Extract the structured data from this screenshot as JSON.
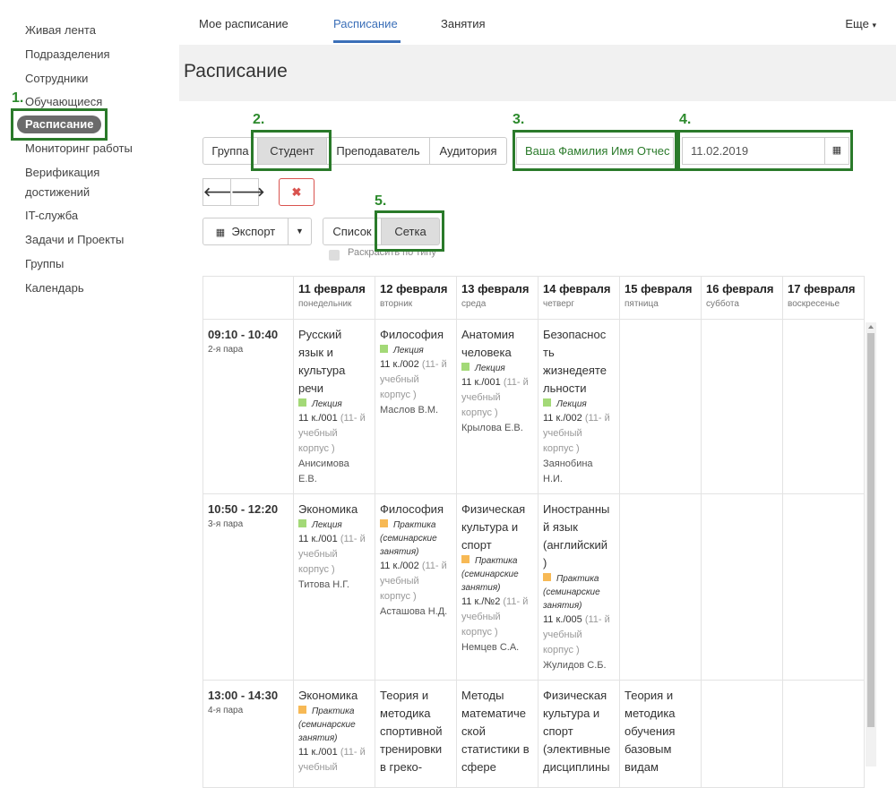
{
  "sidebar": {
    "items": [
      {
        "label": "Живая лента"
      },
      {
        "label": "Подразделения"
      },
      {
        "label": "Сотрудники"
      },
      {
        "label": "Обучающиеся"
      },
      {
        "label": "Расписание"
      },
      {
        "label": "Мониторинг работы"
      },
      {
        "label": "Верификация"
      },
      {
        "label": "достижений"
      },
      {
        "label": "IT-служба"
      },
      {
        "label": "Задачи и Проекты"
      },
      {
        "label": "Группы"
      },
      {
        "label": "Календарь"
      }
    ]
  },
  "annotations": [
    "1.",
    "2.",
    "3.",
    "4.",
    "5."
  ],
  "topnav": {
    "tabs": [
      {
        "label": "Мое расписание"
      },
      {
        "label": "Расписание"
      },
      {
        "label": "Занятия"
      }
    ],
    "more": "Еще"
  },
  "page_title": "Расписание",
  "filters": {
    "group": "Группа",
    "student": "Студент",
    "teacher": "Преподаватель",
    "room": "Аудитория"
  },
  "student_name": "Ваша Фамилия Имя Отчес",
  "date": "11.02.2019",
  "export_label": "Экспорт",
  "view": {
    "list": "Список",
    "grid": "Сетка"
  },
  "color_by_type": "Раскрасить по типу",
  "colors": {
    "lecture": "#a3d977",
    "practice": "#f7b955",
    "accent": "#3b6fb8",
    "annotation": "#2a7a2a"
  },
  "days": [
    {
      "date": "11 февраля",
      "dow": "понедельник"
    },
    {
      "date": "12 февраля",
      "dow": "вторник"
    },
    {
      "date": "13 февраля",
      "dow": "среда"
    },
    {
      "date": "14 февраля",
      "dow": "четверг"
    },
    {
      "date": "15 февраля",
      "dow": "пятница"
    },
    {
      "date": "16 февраля",
      "dow": "суббота"
    },
    {
      "date": "17 февраля",
      "dow": "воскресенье"
    }
  ],
  "slots": [
    {
      "time": "09:10 - 10:40",
      "pair": "2-я пара",
      "cells": [
        {
          "subject": [
            "Русский",
            "язык и",
            "культура",
            "речи"
          ],
          "type": "Лекция",
          "room": "11 к./001",
          "room_sub": [
            "(11-",
            "й учебный",
            "корпус )"
          ],
          "teacher": [
            "Анисимова",
            "Е.В."
          ]
        },
        {
          "subject": [
            "Философия"
          ],
          "type": "Лекция",
          "room": "11 к./002",
          "room_sub": [
            "(11-",
            "й учебный",
            "корпус )"
          ],
          "teacher": [
            "Маслов В.М."
          ]
        },
        {
          "subject": [
            "Анатомия",
            "человека"
          ],
          "type": "Лекция",
          "room": "11 к./001",
          "room_sub": [
            "(11-",
            "й учебный",
            "корпус )"
          ],
          "teacher": [
            "Крылова Е.В."
          ]
        },
        {
          "subject": [
            "Безопаснос",
            "ть",
            "жизнедеяте",
            "льности"
          ],
          "type": "Лекция",
          "room": "11 к./002",
          "room_sub": [
            "(11-",
            "й учебный",
            "корпус )"
          ],
          "teacher": [
            "Заянобина",
            "Н.И."
          ]
        }
      ]
    },
    {
      "time": "10:50 - 12:20",
      "pair": "3-я пара",
      "cells": [
        {
          "subject": [
            "Экономика"
          ],
          "type": "Лекция",
          "room": "11 к./001",
          "room_sub": [
            "(11-",
            "й учебный",
            "корпус )"
          ],
          "teacher": [
            "Титова Н.Г."
          ]
        },
        {
          "subject": [
            "Философия"
          ],
          "type": "Практика (семинарские занятия)",
          "room": "11 к./002",
          "room_sub": [
            "(11-",
            "й учебный",
            "корпус )"
          ],
          "teacher": [
            "Асташова Н.Д."
          ]
        },
        {
          "subject": [
            "Физическая",
            "культура и",
            "спорт"
          ],
          "type": "Практика (семинарские занятия)",
          "room": "11 к./№2",
          "room_sub": [
            "(11-",
            "й учебный",
            "корпус )"
          ],
          "teacher": [
            "Немцев С.А."
          ]
        },
        {
          "subject": [
            "Иностранны",
            "й язык",
            "(английский",
            ")"
          ],
          "type": "Практика (семинарские занятия)",
          "room": "11 к./005",
          "room_sub": [
            "(11-",
            "й учебный",
            "корпус )"
          ],
          "teacher": [
            "Жулидов С.Б."
          ]
        }
      ]
    },
    {
      "time": "13:00 - 14:30",
      "pair": "4-я пара",
      "cells": [
        {
          "subject": [
            "Экономика"
          ],
          "type": "Практика (семинарские занятия)",
          "room": "11 к./001",
          "room_sub": [
            "(11-",
            "й учебный"
          ],
          "teacher": []
        },
        {
          "subject": [
            "Теория и",
            "методика",
            "спортивной",
            "тренировки",
            "в греко-"
          ]
        },
        {
          "subject": [
            "Методы",
            "математиче",
            "ской",
            "статистики в",
            "сфере"
          ]
        },
        {
          "subject": [
            "Физическая",
            "культура и",
            "спорт",
            "(элективные",
            "дисциплины"
          ]
        },
        {
          "subject": [
            "Теория и",
            "методика",
            "обучения",
            "базовым",
            "видам"
          ]
        }
      ]
    }
  ]
}
